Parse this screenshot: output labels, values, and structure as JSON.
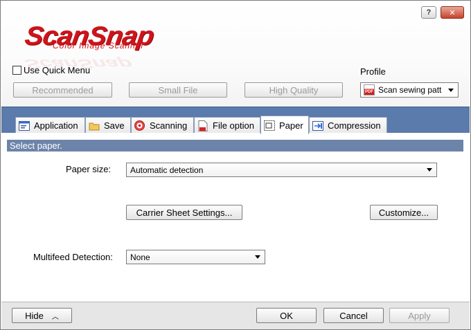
{
  "window": {
    "help_label": "?",
    "close_label": "✕"
  },
  "logo": {
    "main": "ScanSnap",
    "sub": "Color Image Scanner"
  },
  "quick_menu": {
    "label": "Use Quick Menu",
    "checked": false
  },
  "presets": {
    "recommended": "Recommended",
    "small_file": "Small File",
    "high_quality": "High Quality"
  },
  "profile": {
    "label": "Profile",
    "selected": "Scan sewing patt",
    "icon": "pdf-icon"
  },
  "tabs": [
    {
      "label": "Application",
      "icon": "application-icon",
      "active": false
    },
    {
      "label": "Save",
      "icon": "save-folder-icon",
      "active": false
    },
    {
      "label": "Scanning",
      "icon": "scanning-icon",
      "active": false
    },
    {
      "label": "File option",
      "icon": "file-option-icon",
      "active": false
    },
    {
      "label": "Paper",
      "icon": "paper-icon",
      "active": true
    },
    {
      "label": "Compression",
      "icon": "compression-icon",
      "active": false
    }
  ],
  "paper_tab": {
    "section_title": "Select paper.",
    "paper_size_label": "Paper size:",
    "paper_size_value": "Automatic detection",
    "carrier_button": "Carrier Sheet Settings...",
    "customize_button": "Customize...",
    "multifeed_label": "Multifeed Detection:",
    "multifeed_value": "None"
  },
  "footer": {
    "hide": "Hide",
    "ok": "OK",
    "cancel": "Cancel",
    "apply": "Apply"
  },
  "colors": {
    "brand_red": "#d0131a",
    "tab_strip": "#5a7bab",
    "section_bar": "#6d84aa"
  }
}
